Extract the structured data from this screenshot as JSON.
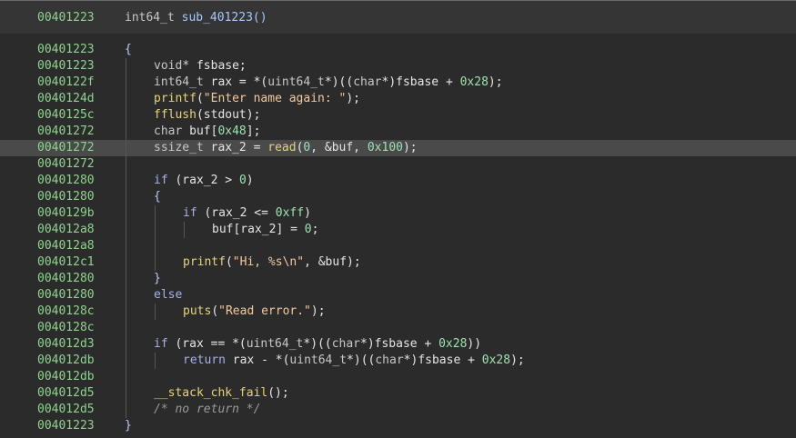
{
  "header": {
    "address": "00401223",
    "ret_type": "int64_t",
    "func_name": "sub_401223()"
  },
  "lines": [
    {
      "addr": "00401223",
      "indent": 0,
      "tokens": [
        [
          "brace",
          "{"
        ]
      ]
    },
    {
      "addr": "00401223",
      "indent": 1,
      "tokens": [
        [
          "type",
          "void"
        ],
        [
          "op",
          "* "
        ],
        [
          "var",
          "fsbase;"
        ]
      ]
    },
    {
      "addr": "0040122f",
      "indent": 1,
      "tokens": [
        [
          "type",
          "int64_t "
        ],
        [
          "var",
          "rax = *("
        ],
        [
          "type",
          "uint64_t"
        ],
        [
          "var",
          "*)(("
        ],
        [
          "type",
          "char"
        ],
        [
          "var",
          "*)fsbase + "
        ],
        [
          "num",
          "0x28"
        ],
        [
          "var",
          ");"
        ]
      ]
    },
    {
      "addr": "0040124d",
      "indent": 1,
      "tokens": [
        [
          "fn",
          "printf"
        ],
        [
          "var",
          "("
        ],
        [
          "str",
          "\"Enter name again: \""
        ],
        [
          "var",
          ");"
        ]
      ]
    },
    {
      "addr": "0040125c",
      "indent": 1,
      "tokens": [
        [
          "fn",
          "fflush"
        ],
        [
          "var",
          "(stdout);"
        ]
      ]
    },
    {
      "addr": "00401272",
      "indent": 1,
      "tokens": [
        [
          "type",
          "char "
        ],
        [
          "var",
          "buf["
        ],
        [
          "num",
          "0x48"
        ],
        [
          "var",
          "];"
        ]
      ]
    },
    {
      "addr": "00401272",
      "indent": 1,
      "highlight": true,
      "tokens": [
        [
          "type",
          "ssize_t "
        ],
        [
          "var",
          "rax_2 = "
        ],
        [
          "fn",
          "read"
        ],
        [
          "var",
          "("
        ],
        [
          "num",
          "0"
        ],
        [
          "var",
          ", &buf, "
        ],
        [
          "num",
          "0x100"
        ],
        [
          "var",
          ");"
        ]
      ]
    },
    {
      "addr": "00401272",
      "indent": 1,
      "tokens": []
    },
    {
      "addr": "00401280",
      "indent": 1,
      "tokens": [
        [
          "kw",
          "if"
        ],
        [
          "var",
          " (rax_2 > "
        ],
        [
          "num",
          "0"
        ],
        [
          "var",
          ")"
        ]
      ]
    },
    {
      "addr": "00401280",
      "indent": 1,
      "tokens": [
        [
          "brace",
          "{"
        ]
      ]
    },
    {
      "addr": "0040129b",
      "indent": 2,
      "tokens": [
        [
          "kw",
          "if"
        ],
        [
          "var",
          " (rax_2 <= "
        ],
        [
          "num",
          "0xff"
        ],
        [
          "var",
          ")"
        ]
      ]
    },
    {
      "addr": "004012a8",
      "indent": 3,
      "tokens": [
        [
          "var",
          "buf[rax_2] = "
        ],
        [
          "num",
          "0"
        ],
        [
          "var",
          ";"
        ]
      ]
    },
    {
      "addr": "004012a8",
      "indent": 2,
      "tokens": []
    },
    {
      "addr": "004012c1",
      "indent": 2,
      "tokens": [
        [
          "fn",
          "printf"
        ],
        [
          "var",
          "("
        ],
        [
          "str",
          "\"Hi, %s\\n\""
        ],
        [
          "var",
          ", &buf);"
        ]
      ]
    },
    {
      "addr": "00401280",
      "indent": 1,
      "tokens": [
        [
          "brace",
          "}"
        ]
      ]
    },
    {
      "addr": "00401280",
      "indent": 1,
      "tokens": [
        [
          "kw",
          "else"
        ]
      ]
    },
    {
      "addr": "0040128c",
      "indent": 2,
      "tokens": [
        [
          "fn",
          "puts"
        ],
        [
          "var",
          "("
        ],
        [
          "str",
          "\"Read error.\""
        ],
        [
          "var",
          ");"
        ]
      ]
    },
    {
      "addr": "0040128c",
      "indent": 1,
      "tokens": []
    },
    {
      "addr": "004012d3",
      "indent": 1,
      "tokens": [
        [
          "kw",
          "if"
        ],
        [
          "var",
          " (rax == *("
        ],
        [
          "type",
          "uint64_t"
        ],
        [
          "var",
          "*)(("
        ],
        [
          "type",
          "char"
        ],
        [
          "var",
          "*)fsbase + "
        ],
        [
          "num",
          "0x28"
        ],
        [
          "var",
          "))"
        ]
      ]
    },
    {
      "addr": "004012db",
      "indent": 2,
      "tokens": [
        [
          "kw",
          "return"
        ],
        [
          "var",
          " rax - *("
        ],
        [
          "type",
          "uint64_t"
        ],
        [
          "var",
          "*)(("
        ],
        [
          "type",
          "char"
        ],
        [
          "var",
          "*)fsbase + "
        ],
        [
          "num",
          "0x28"
        ],
        [
          "var",
          ");"
        ]
      ]
    },
    {
      "addr": "004012db",
      "indent": 1,
      "tokens": []
    },
    {
      "addr": "004012d5",
      "indent": 1,
      "tokens": [
        [
          "fn",
          "__stack_chk_fail"
        ],
        [
          "var",
          "();"
        ]
      ]
    },
    {
      "addr": "004012d5",
      "indent": 1,
      "tokens": [
        [
          "cmt",
          "/* no return */"
        ]
      ]
    },
    {
      "addr": "00401223",
      "indent": 0,
      "tokens": [
        [
          "brace",
          "}"
        ]
      ]
    }
  ]
}
